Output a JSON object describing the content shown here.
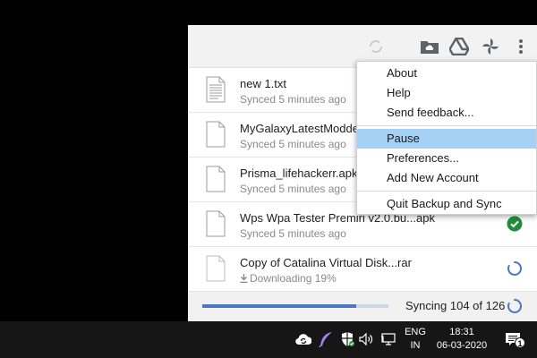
{
  "header": {
    "icons": [
      "folder-cloud-icon",
      "google-drive-icon",
      "google-photos-icon",
      "more-vert-icon"
    ]
  },
  "files": [
    {
      "name": "new 1.txt",
      "status": "Synced 5 minutes ago",
      "icon": "text-file-icon",
      "state": "none"
    },
    {
      "name": "MyGalaxyLatestModded",
      "status": "Synced 5 minutes ago",
      "icon": "file-icon",
      "state": "none"
    },
    {
      "name": "Prisma_lifehackerr.apk",
      "status": "Synced 5 minutes ago",
      "icon": "file-icon",
      "state": "none"
    },
    {
      "name": "Wps Wpa Tester Premiri v2.0.bu...apk",
      "status": "Synced 5 minutes ago",
      "icon": "file-icon",
      "state": "synced-check"
    },
    {
      "name": "Copy of Catalina Virtual Disk...rar",
      "status": "Downloading 19%",
      "icon": "file-icon",
      "state": "syncing-spinner",
      "progress": 0.19
    }
  ],
  "footer": {
    "sync_text": "Syncing 104 of 126",
    "done": 104,
    "total": 126
  },
  "menu": {
    "items": [
      {
        "label": "About"
      },
      {
        "label": "Help"
      },
      {
        "label": "Send feedback..."
      },
      {
        "label": "Pause",
        "highlighted": true
      },
      {
        "label": "Preferences..."
      },
      {
        "label": "Add New Account"
      },
      {
        "label": "Quit Backup and Sync"
      }
    ]
  },
  "taskbar": {
    "lang_line1": "ENG",
    "lang_line2": "IN",
    "time": "18:31",
    "date": "06-03-2020",
    "notification_count": "1"
  },
  "colors": {
    "accent_blue": "#4a76c4",
    "menu_highlight": "#a5d1f5",
    "check_green": "#1e8e3e"
  }
}
